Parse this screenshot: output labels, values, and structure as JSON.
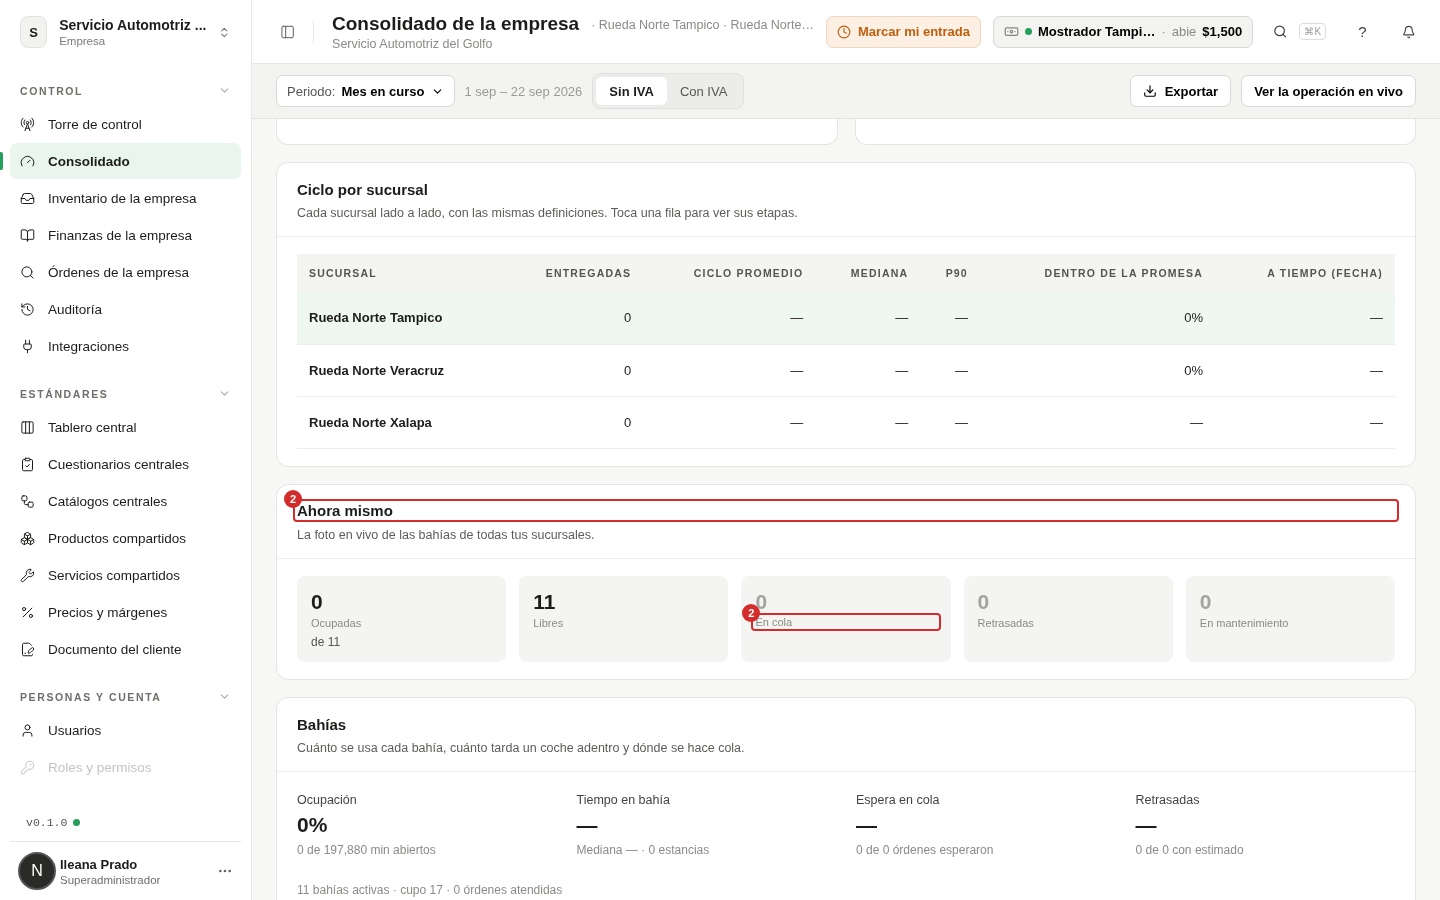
{
  "workspace": {
    "initial": "S",
    "name": "Servicio Automotriz ...",
    "subtitle": "Empresa"
  },
  "sidebar": {
    "sections": [
      {
        "title": "CONTROL",
        "expanded": true,
        "items": [
          {
            "label": "Torre de control",
            "selected": false,
            "faded": false
          },
          {
            "label": "Consolidado",
            "selected": true,
            "faded": false
          },
          {
            "label": "Inventario de la empresa",
            "selected": false,
            "faded": false
          },
          {
            "label": "Finanzas de la empresa",
            "selected": false,
            "faded": false
          },
          {
            "label": "Órdenes de la empresa",
            "selected": false,
            "faded": false
          },
          {
            "label": "Auditoría",
            "selected": false,
            "faded": false
          },
          {
            "label": "Integraciones",
            "selected": false,
            "faded": false
          }
        ]
      },
      {
        "title": "ESTÁNDARES",
        "expanded": true,
        "items": [
          {
            "label": "Tablero central",
            "selected": false,
            "faded": false
          },
          {
            "label": "Cuestionarios centrales",
            "selected": false,
            "faded": false
          },
          {
            "label": "Catálogos centrales",
            "selected": false,
            "faded": false
          },
          {
            "label": "Productos compartidos",
            "selected": false,
            "faded": false
          },
          {
            "label": "Servicios compartidos",
            "selected": false,
            "faded": false
          },
          {
            "label": "Precios y márgenes",
            "selected": false,
            "faded": false
          },
          {
            "label": "Documento del cliente",
            "selected": false,
            "faded": false
          }
        ]
      },
      {
        "title": "PERSONAS Y CUENTA",
        "expanded": true,
        "items": [
          {
            "label": "Usuarios",
            "selected": false,
            "faded": false
          },
          {
            "label": "Roles y permisos",
            "selected": false,
            "faded": true
          }
        ]
      }
    ]
  },
  "version": {
    "label": "v0.1.0",
    "online": true
  },
  "user": {
    "initial": "N",
    "name": "Ileana Prado",
    "role": "Superadministrador"
  },
  "header": {
    "title": "Consolidado de la empresa",
    "subtitle": "Servicio Automotriz del Golfo",
    "breadcrumb": "· Rueda Norte Tampico · Rueda Norte…",
    "clock_in": "Marcar mi entrada",
    "register": {
      "name": "Mostrador Tampi…",
      "separator": "·",
      "status": "abie",
      "amount": "$1,500",
      "open": true
    },
    "shortcut": "⌘K",
    "help": "?"
  },
  "toolbar": {
    "period_label": "Periodo:",
    "period_value": "Mes en curso",
    "range": "1 sep – 22 sep 2026",
    "tax_tabs": [
      {
        "label": "Sin IVA",
        "selected": true
      },
      {
        "label": "Con IVA",
        "selected": false
      }
    ],
    "export": "Exportar",
    "live": "Ver la operación en vivo"
  },
  "cycle": {
    "title": "Ciclo por sucursal",
    "description": "Cada sucursal lado a lado, con las mismas definiciones. Toca una fila para ver sus etapas.",
    "columns": [
      "SUCURSAL",
      "ENTREGADAS",
      "CICLO PROMEDIO",
      "MEDIANA",
      "P90",
      "DENTRO DE LA PROMESA",
      "A TIEMPO (FECHA)"
    ],
    "rows": [
      {
        "selected": true,
        "cells": [
          "Rueda Norte Tampico",
          "0",
          "—",
          "—",
          "—",
          "0%",
          "—"
        ]
      },
      {
        "selected": false,
        "cells": [
          "Rueda Norte Veracruz",
          "0",
          "—",
          "—",
          "—",
          "0%",
          "—"
        ]
      },
      {
        "selected": false,
        "cells": [
          "Rueda Norte Xalapa",
          "0",
          "—",
          "—",
          "—",
          "—",
          "—"
        ]
      }
    ]
  },
  "now": {
    "title": "Ahora mismo",
    "annotation": "2",
    "description": "La foto en vivo de las bahías de todas tus sucursales.",
    "stats": [
      {
        "value": "0",
        "label": "Ocupadas",
        "note": "de 11",
        "muted": false
      },
      {
        "value": "11",
        "label": "Libres",
        "muted": false
      },
      {
        "value": "0",
        "label": "En cola",
        "muted": true,
        "annotation": "2"
      },
      {
        "value": "0",
        "label": "Retrasadas",
        "muted": true
      },
      {
        "value": "0",
        "label": "En mantenimiento",
        "muted": true
      }
    ]
  },
  "bays": {
    "title": "Bahías",
    "description": "Cuánto se usa cada bahía, cuánto tarda un coche adentro y dónde se hace cola.",
    "metrics": [
      {
        "label": "Ocupación",
        "value": "0%",
        "note": "0 de 197,880 min abiertos"
      },
      {
        "label": "Tiempo en bahía",
        "value": "—",
        "note": "Mediana — · 0 estancias"
      },
      {
        "label": "Espera en cola",
        "value": "—",
        "note": "0 de 0 órdenes esperaron"
      },
      {
        "label": "Retrasadas",
        "value": "—",
        "note": "0 de 0 con estimado"
      }
    ],
    "footer": "11 bahías activas · cupo 17 · 0 órdenes atendidas"
  }
}
